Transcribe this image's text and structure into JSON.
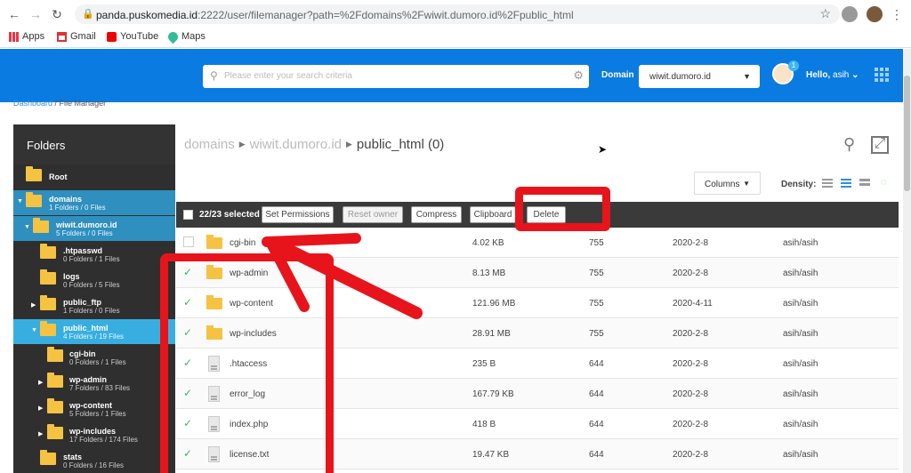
{
  "browser": {
    "url_host": "panda.puskomedia.id",
    "url_rest": ":2222/user/filemanager?path=%2Fdomains%2Fwiwit.dumoro.id%2Fpublic_html",
    "bookmarks": [
      {
        "label": "Apps",
        "icon": "apps-grid-icon"
      },
      {
        "label": "Gmail",
        "icon": "gmail-icon"
      },
      {
        "label": "YouTube",
        "icon": "youtube-icon"
      },
      {
        "label": "Maps",
        "icon": "maps-pin-icon"
      }
    ]
  },
  "header": {
    "search_placeholder": "Please enter your search criteria",
    "domain_label": "Domain",
    "domain_value": "wiwit.dumoro.id",
    "notification_count": "1",
    "hello": "Hello,",
    "username": "asih"
  },
  "breadcrumb": {
    "link": "Dashboard",
    "current": "/ File Manager"
  },
  "sidebar": {
    "title": "Folders",
    "items": [
      {
        "name": "Root",
        "counts": ""
      },
      {
        "name": "domains",
        "counts": "1 Folders / 0 Files"
      },
      {
        "name": "wiwit.dumoro.id",
        "counts": "5 Folders / 0 Files"
      },
      {
        "name": ".htpasswd",
        "counts": "0 Folders / 1 Files"
      },
      {
        "name": "logs",
        "counts": "0 Folders / 5 Files"
      },
      {
        "name": "public_ftp",
        "counts": "1 Folders / 0 Files"
      },
      {
        "name": "public_html",
        "counts": "4 Folders / 19 Files"
      },
      {
        "name": "cgi-bin",
        "counts": "0 Folders / 1 Files"
      },
      {
        "name": "wp-admin",
        "counts": "7 Folders / 83 Files"
      },
      {
        "name": "wp-content",
        "counts": "5 Folders / 1 Files"
      },
      {
        "name": "wp-includes",
        "counts": "17 Folders / 174 Files"
      },
      {
        "name": "stats",
        "counts": "0 Folders / 16 Files"
      }
    ]
  },
  "main": {
    "path": [
      "domains",
      "wiwit.dumoro.id",
      "public_html"
    ],
    "path_count": "(0)",
    "columns_label": "Columns",
    "density_label": "Density:",
    "selection": "22/23 selected",
    "actions": [
      {
        "label": "Set Permissions",
        "enabled": true
      },
      {
        "label": "Reset owner",
        "enabled": false
      },
      {
        "label": "Compress",
        "enabled": true
      },
      {
        "label": "Clipboard",
        "enabled": true
      },
      {
        "label": "Delete",
        "enabled": true
      }
    ],
    "files": [
      {
        "name": "cgi-bin",
        "type": "folder",
        "size": "4.02 KB",
        "perm": "755",
        "date": "2020-2-8",
        "owner": "asih/asih",
        "checked": false
      },
      {
        "name": "wp-admin",
        "type": "folder",
        "size": "8.13 MB",
        "perm": "755",
        "date": "2020-2-8",
        "owner": "asih/asih",
        "checked": true
      },
      {
        "name": "wp-content",
        "type": "folder",
        "size": "121.96 MB",
        "perm": "755",
        "date": "2020-4-11",
        "owner": "asih/asih",
        "checked": true
      },
      {
        "name": "wp-includes",
        "type": "folder",
        "size": "28.91 MB",
        "perm": "755",
        "date": "2020-2-8",
        "owner": "asih/asih",
        "checked": true
      },
      {
        "name": ".htaccess",
        "type": "file",
        "size": "235 B",
        "perm": "644",
        "date": "2020-2-8",
        "owner": "asih/asih",
        "checked": true
      },
      {
        "name": "error_log",
        "type": "file",
        "size": "167.79 KB",
        "perm": "644",
        "date": "2020-2-8",
        "owner": "asih/asih",
        "checked": true
      },
      {
        "name": "index.php",
        "type": "file",
        "size": "418 B",
        "perm": "644",
        "date": "2020-2-8",
        "owner": "asih/asih",
        "checked": true
      },
      {
        "name": "license.txt",
        "type": "file",
        "size": "19.47 KB",
        "perm": "644",
        "date": "2020-2-8",
        "owner": "asih/asih",
        "checked": true
      }
    ]
  },
  "colors": {
    "header_blue": "#0a7be0",
    "sidebar_dark": "#2f2f2f",
    "selected_blue": "#38aee0",
    "folder_yellow": "#f5c242",
    "annotation_red": "#e8141c"
  }
}
